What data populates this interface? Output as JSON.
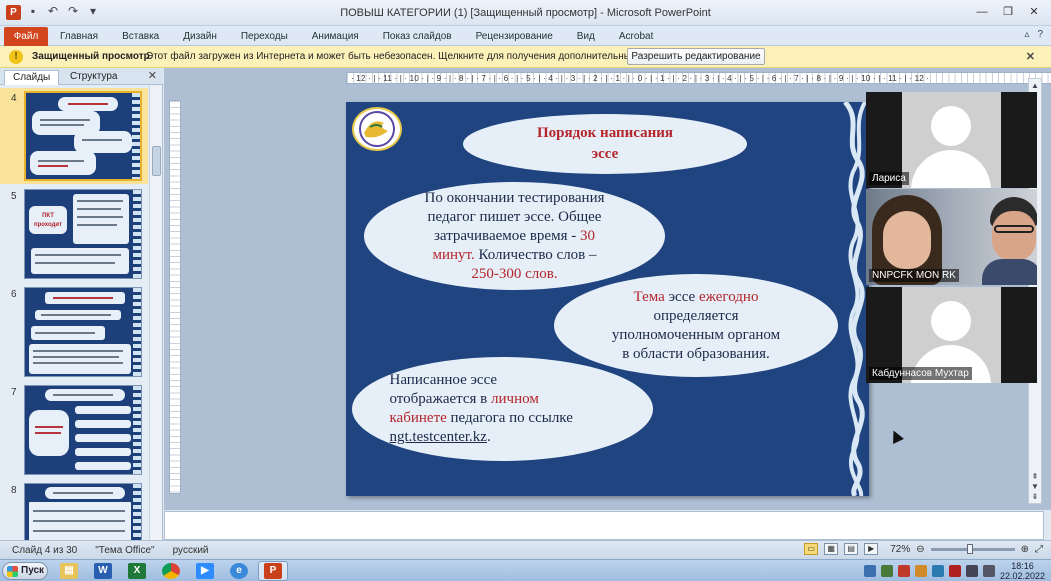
{
  "window": {
    "title": "ПОВЫШ КАТЕГОРИИ (1) [Защищенный просмотр] - Microsoft PowerPoint",
    "app_icon": "P"
  },
  "ribbon": {
    "file_tab": "Файл",
    "tabs": [
      "Главная",
      "Вставка",
      "Дизайн",
      "Переходы",
      "Анимация",
      "Показ слайдов",
      "Рецензирование",
      "Вид",
      "Acrobat"
    ]
  },
  "protected_view": {
    "title": "Защищенный просмотр",
    "message": "Этот файл загружен из Интернета и может быть небезопасен. Щелкните для получения дополнительных сведений.",
    "enable_button": "Разрешить редактирование"
  },
  "left_panel": {
    "tab_slides": "Слайды",
    "tab_outline": "Структура",
    "thumbnails": [
      {
        "num": "4",
        "selected": true
      },
      {
        "num": "5",
        "selected": false,
        "label": "ПКТ проходит"
      },
      {
        "num": "6",
        "selected": false
      },
      {
        "num": "7",
        "selected": false
      },
      {
        "num": "8",
        "selected": false
      }
    ]
  },
  "ruler": {
    "horizontal": "· 12 · | · 11 · | · 10 · | · 9 · | · 8 · | · 7 · | · 6 · | · 5 · | · 4 · | · 3 · | · 2 · | · 1 · | · 0 · | · 1 · | · 2 · | · 3 · | · 4 · | · 5 · | · 6 · | · 7 · | · 8 · | · 9 · | · 10 · | · 11 · | · 12 ·"
  },
  "slide": {
    "title_line1": "Порядок написания",
    "title_line2": "эссе",
    "e1_l1": "По окончании тестирования",
    "e1_l2": "педагог пишет эссе. Общее",
    "e1_l3a": "затрачиваемое  время - ",
    "e1_l3b": "30",
    "e1_l4a": "минут.",
    "e1_l4b": "  Количество слов –",
    "e1_l5": "250-300 слов.",
    "e2_l1a": "Тема",
    "e2_l1b": " эссе ",
    "e2_l1c": "ежегодно",
    "e2_l2": "определяется",
    "e2_l3": "уполномоченным органом",
    "e2_l4": "в области образования.",
    "e3_l1": "Написанное эссе",
    "e3_l2a": "отображается  в ",
    "e3_l2b": "личном",
    "e3_l3a": "кабинете",
    "e3_l3b": " педагога по ссылке",
    "e3_l4a": "ngt.testcenter.kz",
    "e3_l4b": "."
  },
  "video": {
    "tile1_name": "Лариса",
    "tile2_name": "NNPCFK MON RK",
    "tile3_name": "Кабдуннасов Мухтар"
  },
  "statusbar": {
    "slide_info": "Слайд 4 из 30",
    "theme": "\"Тема Office\"",
    "language": "русский",
    "zoom": "72%"
  },
  "taskbar": {
    "start": "Пуск",
    "time": "18:16",
    "date": "22.02.2022"
  },
  "colors": {
    "slide_bg": "#1f447f",
    "accent_red": "#b5252c",
    "file_tab": "#d1461f",
    "protected_bar": "#fdf1ba"
  }
}
